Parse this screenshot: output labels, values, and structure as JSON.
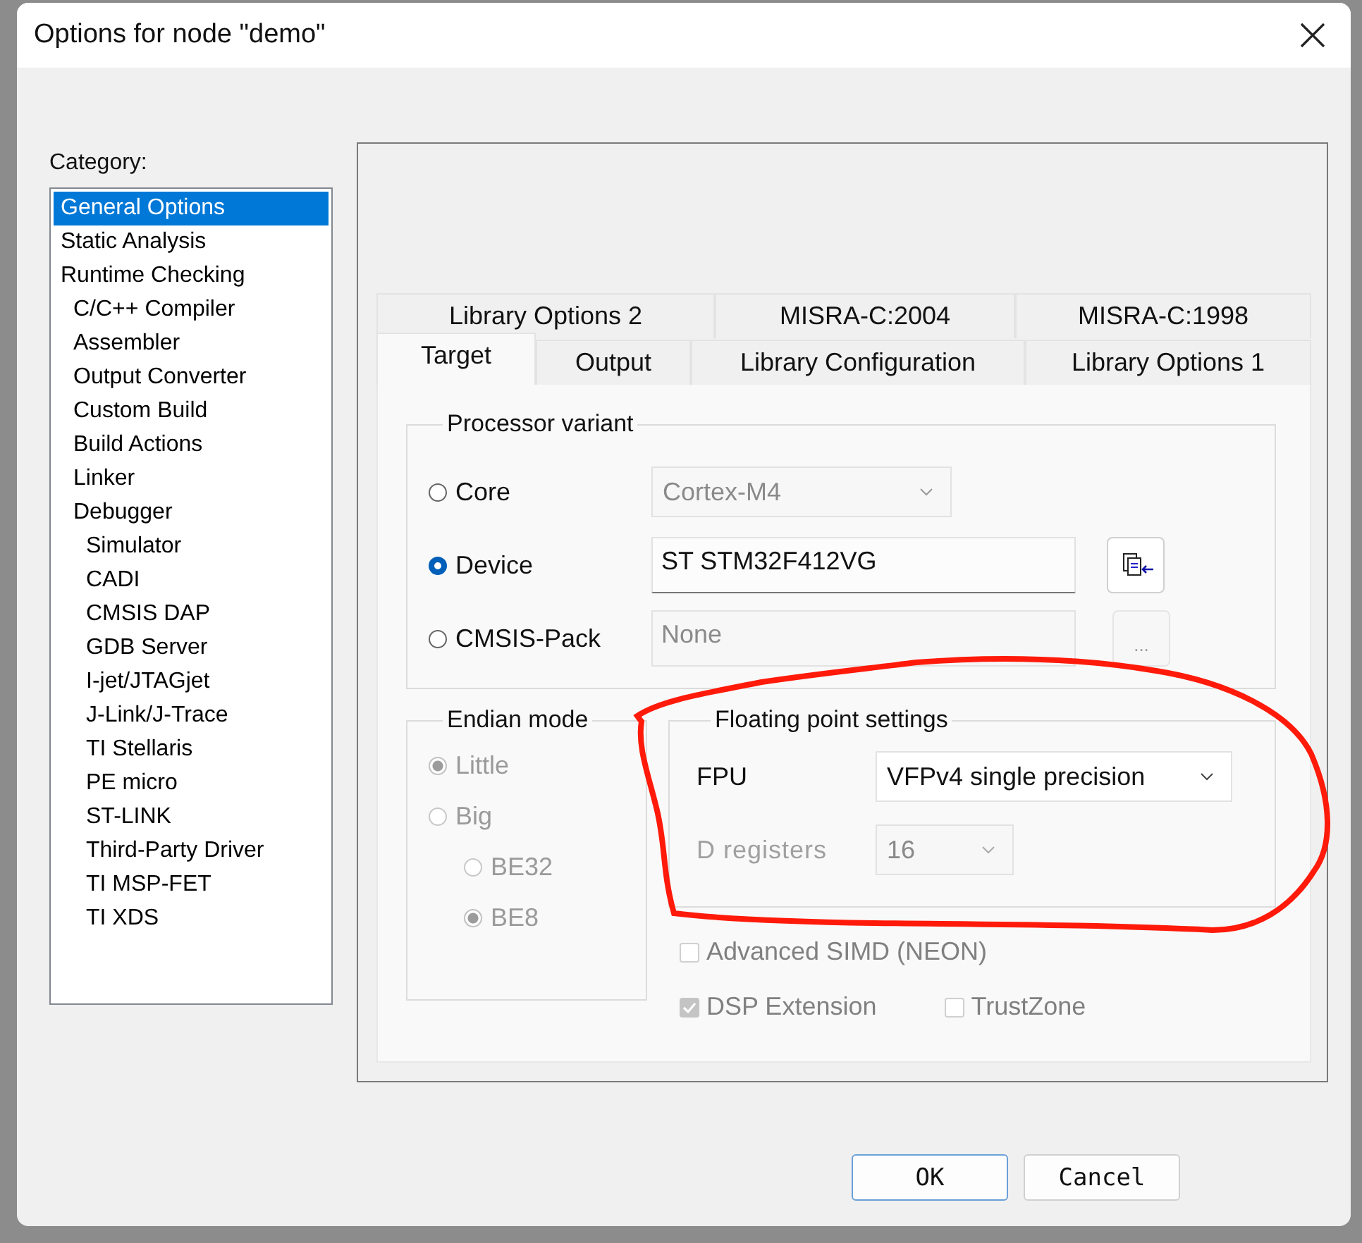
{
  "window": {
    "title": "Options for node \"demo\""
  },
  "category": {
    "label": "Category:",
    "items": [
      {
        "label": "General Options",
        "selected": true
      },
      {
        "label": "Static Analysis",
        "selected": false
      },
      {
        "label": "Runtime Checking",
        "selected": false,
        "children": [
          {
            "label": "C/C++ Compiler",
            "selected": false
          },
          {
            "label": "Assembler",
            "selected": false
          },
          {
            "label": "Output Converter",
            "selected": false
          },
          {
            "label": "Custom Build",
            "selected": false
          },
          {
            "label": "Build Actions",
            "selected": false
          },
          {
            "label": "Linker",
            "selected": false
          },
          {
            "label": "Debugger",
            "selected": false,
            "children": [
              {
                "label": "Simulator",
                "selected": false
              },
              {
                "label": "CADI",
                "selected": false
              },
              {
                "label": "CMSIS DAP",
                "selected": false
              },
              {
                "label": "GDB Server",
                "selected": false
              },
              {
                "label": "I-jet/JTAGjet",
                "selected": false
              },
              {
                "label": "J-Link/J-Trace",
                "selected": false
              },
              {
                "label": "TI Stellaris",
                "selected": false
              },
              {
                "label": "PE micro",
                "selected": false
              },
              {
                "label": "ST-LINK",
                "selected": false
              },
              {
                "label": "Third-Party Driver",
                "selected": false
              },
              {
                "label": "TI MSP-FET",
                "selected": false
              },
              {
                "label": "TI XDS",
                "selected": false
              }
            ]
          }
        ]
      }
    ]
  },
  "tab_rows": [
    [
      {
        "label": "Library Options 2",
        "selected": false
      },
      {
        "label": "MISRA-C:2004",
        "selected": false
      },
      {
        "label": "MISRA-C:1998",
        "selected": false
      }
    ],
    [
      {
        "label": "Target",
        "selected": true
      },
      {
        "label": "Output",
        "selected": false
      },
      {
        "label": "Library Configuration",
        "selected": false
      },
      {
        "label": "Library Options 1",
        "selected": false
      }
    ]
  ],
  "processor_variant": {
    "title": "Processor variant",
    "options": [
      {
        "label": "Core",
        "selected": false,
        "kind": "dropdown",
        "value": "Cortex-M4",
        "disabled": true
      },
      {
        "label": "Device",
        "selected": true,
        "kind": "field",
        "value": "ST STM32F412VG",
        "disabled": false,
        "button": {
          "kind": "icon",
          "disabled": false
        }
      },
      {
        "label": "CMSIS-Pack",
        "selected": false,
        "kind": "field",
        "value": "None",
        "disabled": true,
        "button": {
          "kind": "text",
          "label": "...",
          "disabled": true
        }
      }
    ]
  },
  "endian_mode": {
    "title": "Endian mode",
    "disabled": true,
    "options": [
      {
        "label": "Little",
        "selected": true
      },
      {
        "label": "Big",
        "selected": false,
        "children": [
          {
            "label": "BE32",
            "selected": false
          },
          {
            "label": "BE8",
            "selected": true
          }
        ]
      }
    ]
  },
  "floating_point": {
    "title": "Floating point settings",
    "fields": [
      {
        "label": "FPU",
        "value": "VFPv4 single precision",
        "disabled": false
      },
      {
        "label": "D registers",
        "value": "16",
        "disabled": true
      }
    ]
  },
  "checkboxes": [
    [
      {
        "label": "Advanced SIMD (NEON)",
        "checked": false,
        "disabled": true
      }
    ],
    [
      {
        "label": "DSP Extension",
        "checked": true,
        "disabled": true
      },
      {
        "label": "TrustZone",
        "checked": false,
        "disabled": true
      }
    ]
  ],
  "buttons": [
    {
      "label": "OK",
      "default": true
    },
    {
      "label": "Cancel",
      "default": false
    }
  ]
}
